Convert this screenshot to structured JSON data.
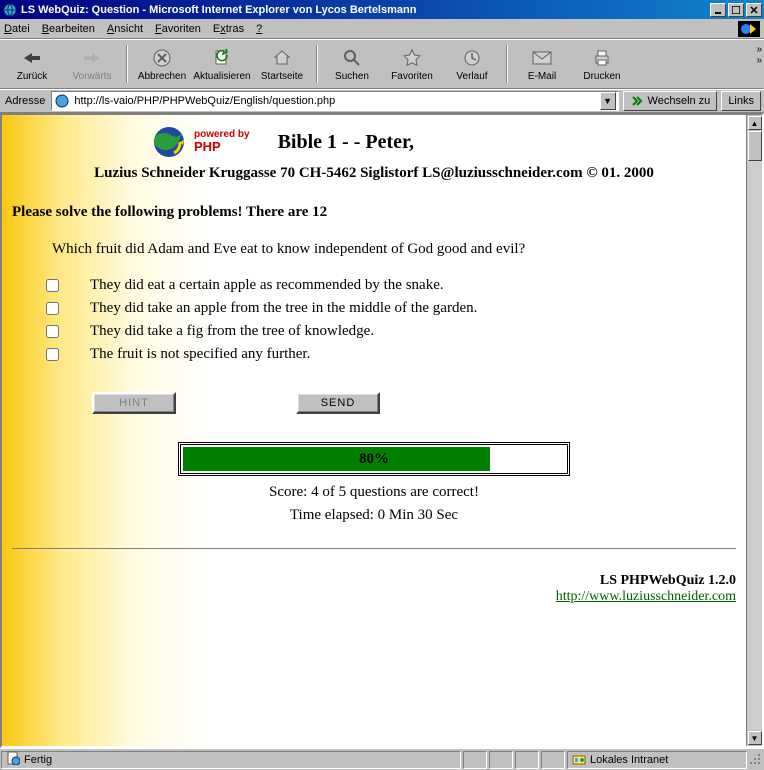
{
  "window": {
    "title": "LS WebQuiz: Question - Microsoft Internet Explorer von Lycos Bertelsmann"
  },
  "menu": {
    "items": [
      "Datei",
      "Bearbeiten",
      "Ansicht",
      "Favoriten",
      "Extras",
      "?"
    ]
  },
  "toolbar": {
    "back": "Zurück",
    "forward": "Vorwärts",
    "stop": "Abbrechen",
    "refresh": "Aktualisieren",
    "home": "Startseite",
    "search": "Suchen",
    "favorites": "Favoriten",
    "history": "Verlauf",
    "mail": "E-Mail",
    "print": "Drucken"
  },
  "addressbar": {
    "label": "Adresse",
    "url": "http://ls-vaio/PHP/PHPWebQuiz/English/question.php",
    "go": "Wechseln zu",
    "links": "Links"
  },
  "page": {
    "powered_label": "powered by",
    "powered_name": "PHP",
    "title": "Bible 1 - - Peter,",
    "author": "Luzius Schneider Kruggasse 70 CH-5462 Siglistorf LS@luziusschneider.com © 01. 2000",
    "instruction": "Please solve the following problems! There are 12",
    "question": "Which fruit did Adam and Eve eat to know independent of God good and evil?",
    "answers": [
      "They did eat a certain apple as recommended by the snake.",
      "They did take an apple from the tree in the middle of the garden.",
      "They did take a fig from the tree of knowledge.",
      "The fruit is not specified any further."
    ],
    "hint_label": "HINT",
    "send_label": "SEND",
    "progress_pct": 80,
    "progress_label": "80%",
    "score": "Score: 4 of 5 questions are correct!",
    "time": "Time elapsed: 0 Min 30 Sec",
    "product": "LS PHPWebQuiz 1.2.0",
    "link": "http://www.luziusschneider.com"
  },
  "status": {
    "ready": "Fertig",
    "zone": "Lokales Intranet"
  }
}
